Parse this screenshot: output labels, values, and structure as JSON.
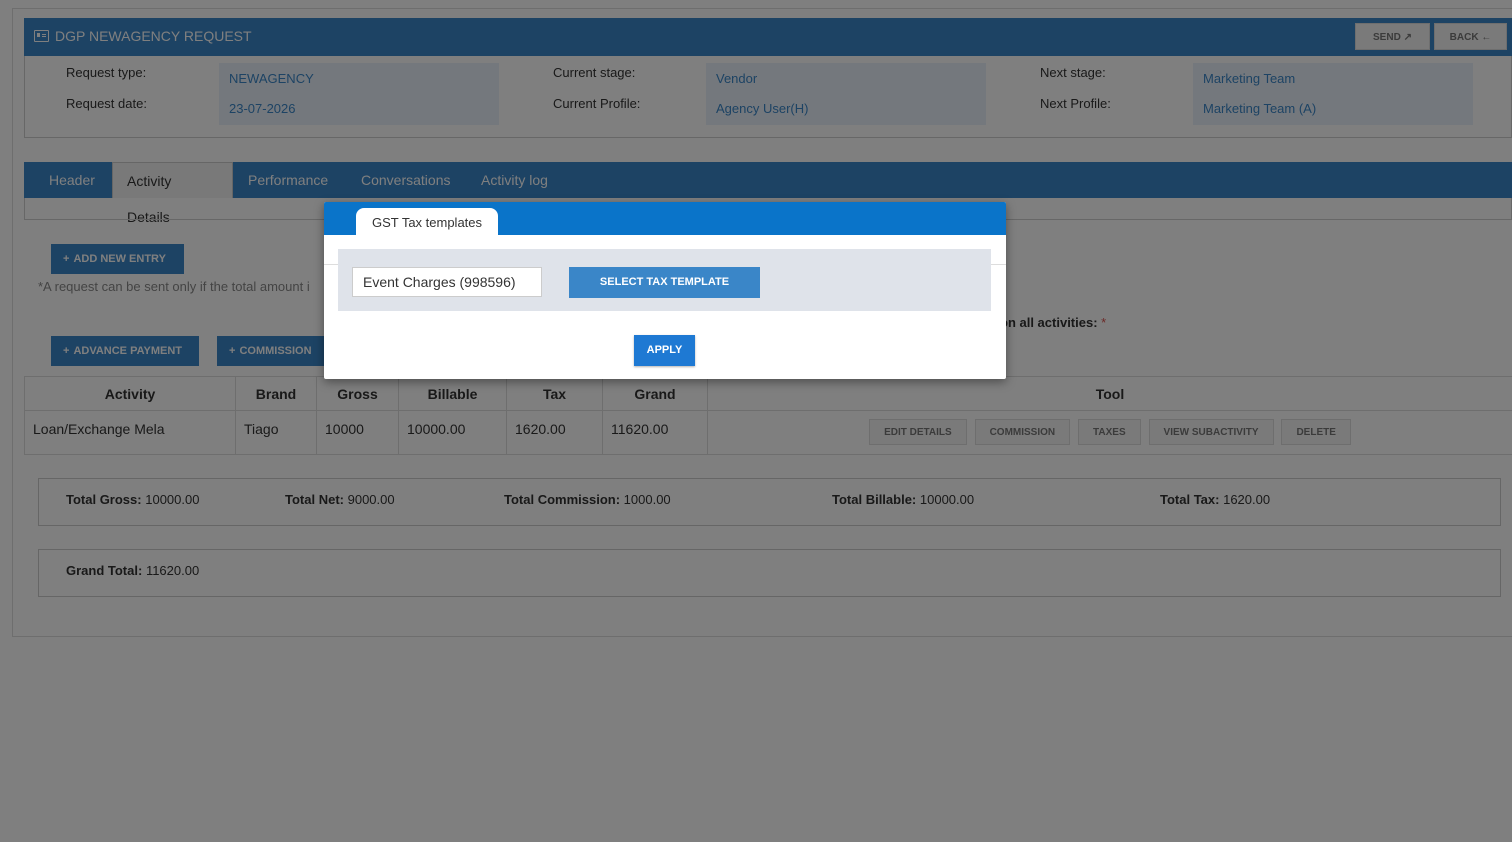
{
  "header": {
    "title": "DGP NEWAGENCY REQUEST",
    "title_icon": "id-card-icon",
    "send_label": "SEND",
    "send_icon": "send-icon",
    "back_label": "BACK",
    "back_icon": "arrow-left-icon"
  },
  "info": {
    "request_type_label": "Request type:",
    "request_type_value": "NEWAGENCY",
    "request_date_label": "Request date:",
    "request_date_value": "23-07-2026",
    "current_stage_label": "Current stage:",
    "current_stage_value": "Vendor",
    "current_profile_label": "Current Profile:",
    "current_profile_value": "Agency User(H)",
    "next_stage_label": "Next stage:",
    "next_stage_value": "Marketing Team",
    "next_profile_label": "Next Profile:",
    "next_profile_value": "Marketing Team (A)"
  },
  "tabs": [
    "Header",
    "Activity Details",
    "Performance",
    "Conversations",
    "Activity log"
  ],
  "active_tab": "Activity Details",
  "actions": {
    "add_new_entry": "ADD NEW ENTRY",
    "note": "*A request can be sent only if the total amount i",
    "activities_note": "on all activities:",
    "required_mark": "*",
    "advance_payment": "ADVANCE PAYMENT",
    "commission": "COMMISSION"
  },
  "table": {
    "columns": [
      "Activity",
      "Brand",
      "Gross",
      "Billable",
      "Tax",
      "Grand",
      "Tool"
    ],
    "rows": [
      {
        "activity": "Loan/Exchange Mela",
        "brand": "Tiago",
        "gross": "10000",
        "billable": "10000.00",
        "tax": "1620.00",
        "grand": "11620.00"
      }
    ],
    "tool_buttons": [
      "EDIT DETAILS",
      "COMMISSION",
      "TAXES",
      "VIEW SUBACTIVITY",
      "DELETE"
    ]
  },
  "summary": {
    "total_gross_label": "Total Gross:",
    "total_gross_value": "10000.00",
    "total_net_label": "Total Net:",
    "total_net_value": "9000.00",
    "total_commission_label": "Total Commission:",
    "total_commission_value": "1000.00",
    "total_billable_label": "Total Billable:",
    "total_billable_value": "10000.00",
    "total_tax_label": "Total Tax:",
    "total_tax_value": "1620.00",
    "grand_total_label": "Grand Total:",
    "grand_total_value": "11620.00"
  },
  "modal": {
    "tab_label": "GST Tax templates",
    "input_value": "Event Charges (998596)",
    "select_button": "SELECT TAX TEMPLATE",
    "apply_button": "APPLY"
  },
  "colors": {
    "primary": "#3a86c8",
    "modal_header": "#0a74c9",
    "value_text": "#3a86c8",
    "required": "#d9534f"
  }
}
